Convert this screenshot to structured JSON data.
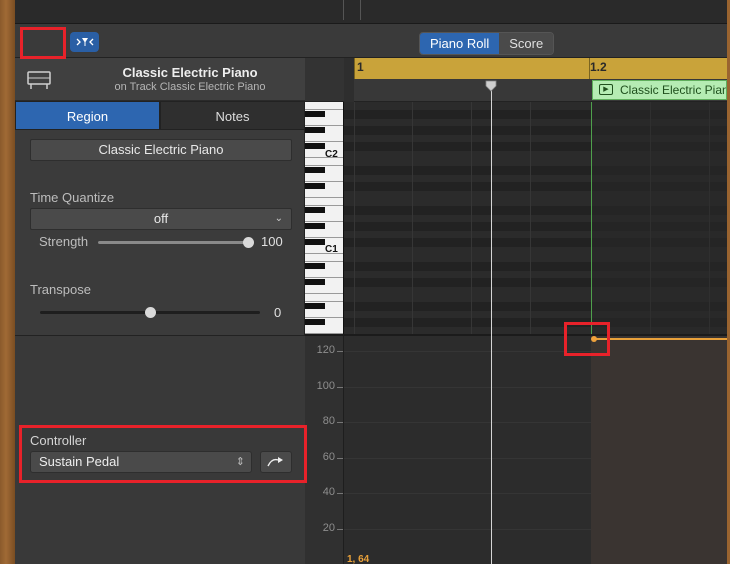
{
  "toolbar": {
    "view_segment": [
      "Piano Roll",
      "Score"
    ],
    "active_view": "Piano Roll"
  },
  "instrument": {
    "title": "Classic Electric Piano",
    "subtitle": "on Track Classic Electric Piano"
  },
  "inspector": {
    "tabs": [
      "Region",
      "Notes"
    ],
    "active_tab": "Region",
    "region_name": "Classic Electric Piano",
    "time_quantize_label": "Time Quantize",
    "time_quantize_value": "off",
    "strength_label": "Strength",
    "strength_value": "100",
    "strength_fraction": 1.0,
    "transpose_label": "Transpose",
    "transpose_value": "0",
    "transpose_fraction": 0.5,
    "controller_label": "Controller",
    "controller_value": "Sustain Pedal"
  },
  "ruler": {
    "bar_1": "1",
    "bar_1_2": "1.2"
  },
  "region_label": "Classic Electric Piano",
  "keyboard_labels": [
    "C2",
    "C1"
  ],
  "automation_scale": [
    "120",
    "100",
    "80",
    "60",
    "40",
    "20"
  ],
  "position_readout": "1, 64",
  "colors": {
    "accent_blue": "#2d66b0",
    "ruler_gold": "#c9a33a",
    "region_green": "#b5ecb3",
    "automation_orange": "#e9a13a",
    "highlight_red": "#e8222a"
  }
}
